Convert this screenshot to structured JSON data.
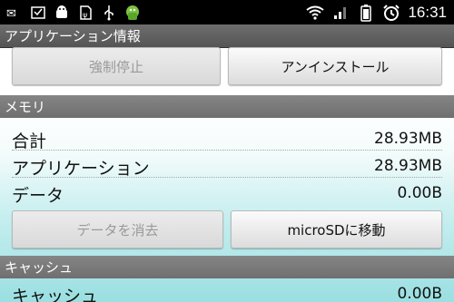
{
  "statusbar": {
    "icons_left": [
      "email-icon",
      "download-icon",
      "android-debug-icon",
      "sd-usb-icon",
      "usb-icon",
      "app-icon"
    ],
    "icons_right": [
      "wifi-icon",
      "signal-icon",
      "battery-icon",
      "alarm-icon"
    ],
    "time": "16:31"
  },
  "title": "アプリケーション情報",
  "buttons": {
    "force_stop": "強制停止",
    "uninstall": "アンインストール",
    "clear_data": "データを消去",
    "move_to_sd": "microSDに移動"
  },
  "memory": {
    "header": "メモリ",
    "rows": [
      {
        "label": "合計",
        "value": "28.93MB"
      },
      {
        "label": "アプリケーション",
        "value": "28.93MB"
      },
      {
        "label": "データ",
        "value": "0.00B"
      }
    ]
  },
  "cache": {
    "header": "キャッシュ",
    "rows": [
      {
        "label": "キャッシュ",
        "value": "0.00B"
      }
    ]
  },
  "colors": {
    "status_bar": "#000000",
    "title_bar": "#5f5f5f",
    "section_header": "#7a7a7a",
    "background_bottom": "#9adfe1"
  }
}
